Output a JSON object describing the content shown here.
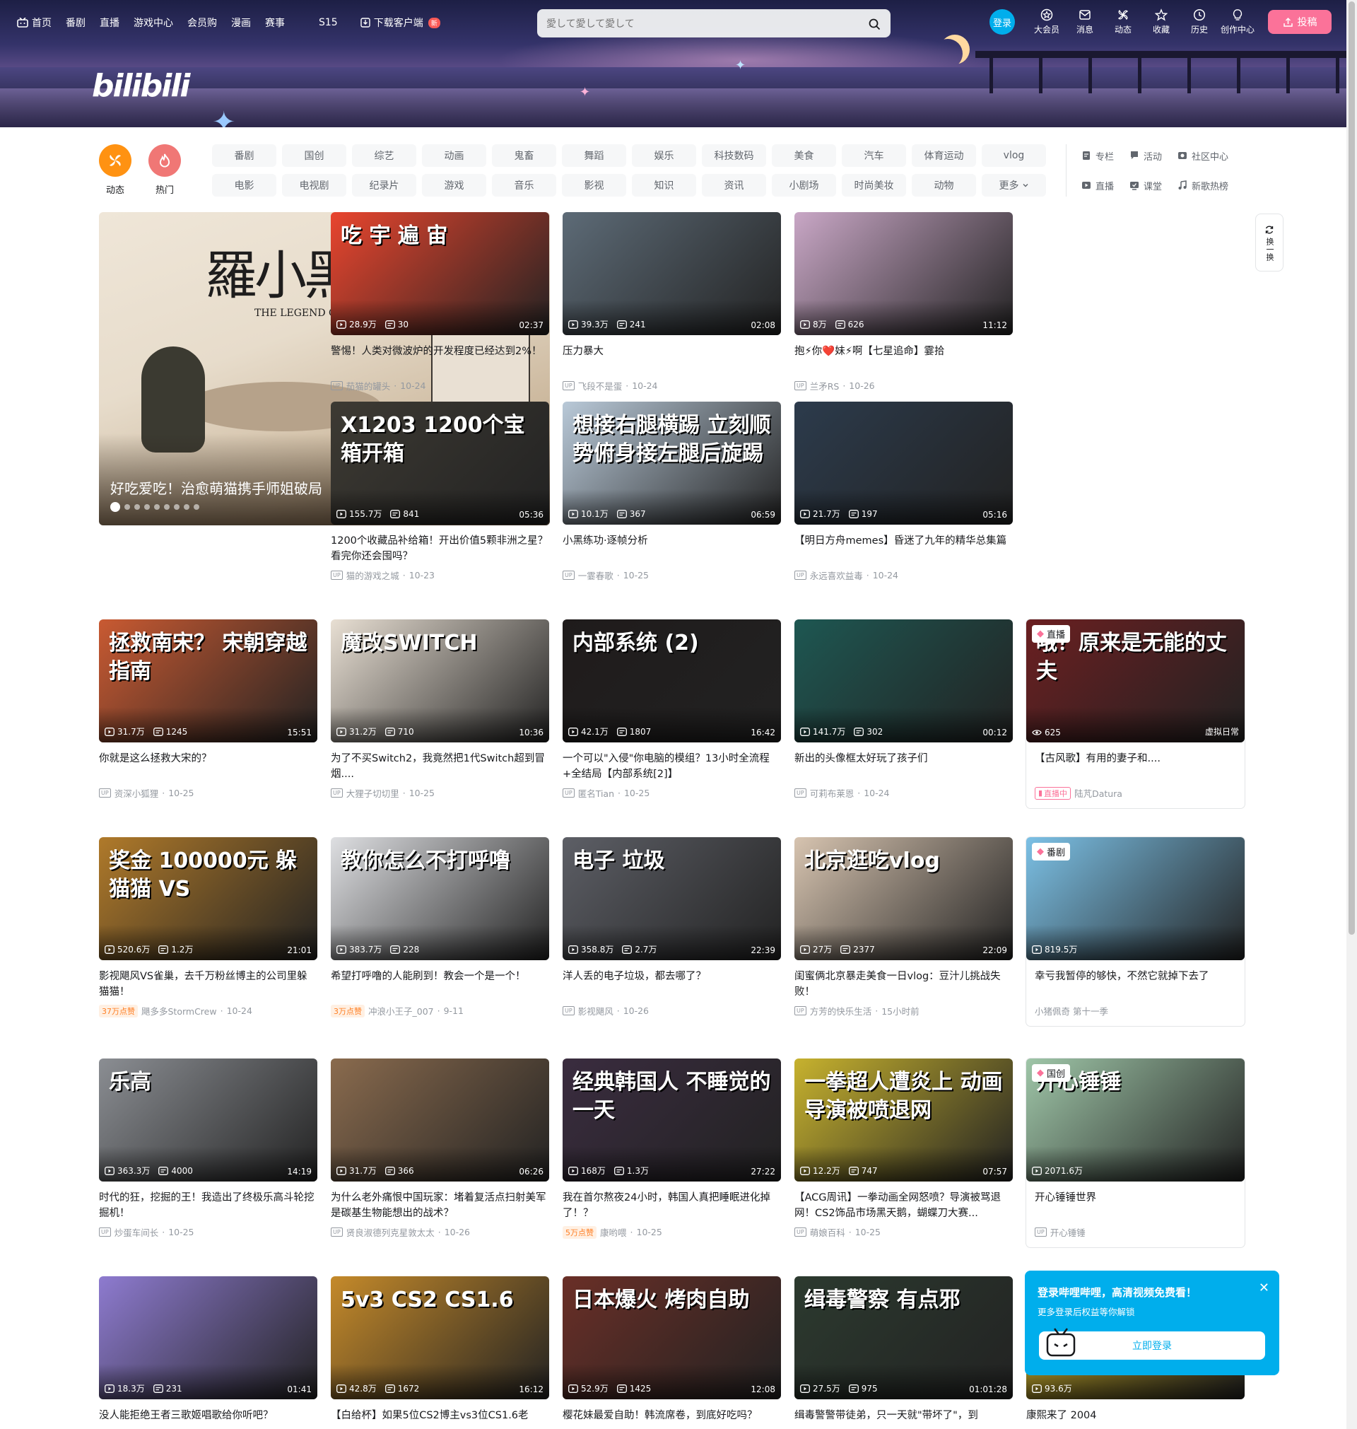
{
  "header": {
    "nav_left": [
      {
        "label": "首页",
        "icon": "tv-icon"
      },
      {
        "label": "番剧"
      },
      {
        "label": "直播"
      },
      {
        "label": "游戏中心"
      },
      {
        "label": "会员购"
      },
      {
        "label": "漫画"
      },
      {
        "label": "赛事"
      },
      {
        "label": "S15"
      },
      {
        "label": "下载客户端",
        "icon": "download-icon",
        "badge": "新"
      }
    ],
    "search_placeholder": "愛して愛して愛して",
    "login_label": "登录",
    "nav_right": [
      {
        "label": "大会员",
        "icon": "vip-icon"
      },
      {
        "label": "消息",
        "icon": "message-icon"
      },
      {
        "label": "动态",
        "icon": "dynamic-icon"
      },
      {
        "label": "收藏",
        "icon": "favorite-icon"
      },
      {
        "label": "历史",
        "icon": "history-icon"
      },
      {
        "label": "创作中心",
        "icon": "creator-icon"
      }
    ],
    "upload_label": "投稿",
    "logo_text": "bilibili"
  },
  "quick": [
    {
      "label": "动态",
      "icon": "dynamic-icon",
      "color": "#ff9212"
    },
    {
      "label": "热门",
      "icon": "fire-icon",
      "color": "#f07775"
    }
  ],
  "channels": [
    "番剧",
    "国创",
    "综艺",
    "动画",
    "鬼畜",
    "舞蹈",
    "娱乐",
    "科技数码",
    "美食",
    "汽车",
    "体育运动",
    "vlog",
    "电影",
    "电视剧",
    "纪录片",
    "游戏",
    "音乐",
    "影视",
    "知识",
    "资讯",
    "小剧场",
    "时尚美妆",
    "动物",
    "更多"
  ],
  "side_links": [
    {
      "label": "专栏",
      "icon": "column-icon"
    },
    {
      "label": "活动",
      "icon": "activity-icon"
    },
    {
      "label": "社区中心",
      "icon": "community-icon"
    },
    {
      "label": "直播",
      "icon": "live-icon"
    },
    {
      "label": "课堂",
      "icon": "classroom-icon"
    },
    {
      "label": "新歌热榜",
      "icon": "music-icon"
    }
  ],
  "carousel": {
    "caption": "好吃爱吃！治愈萌猫携手师姐破局",
    "art_title": "羅小黑戰記",
    "art_sub": "THE LEGEND OF HEI Ⅱ",
    "dots": 9
  },
  "refresh_label": "换一换",
  "cards": [
    {
      "title": "警惕！人类对微波炉的开发程度已经达到2%！",
      "views": "28.9万",
      "danmaku": "30",
      "duration": "02:37",
      "author": "茄猫的罐头",
      "date": "10-24",
      "art": "吃 宇 遍 宙",
      "bg": "#e9452e"
    },
    {
      "title": "压力暴大",
      "views": "39.3万",
      "danmaku": "241",
      "duration": "02:08",
      "author": "飞段不是蛋",
      "date": "10-24",
      "art": "",
      "bg": "#5d6b77"
    },
    {
      "title": "抱⚡你❤️妹⚡啊【七星追命】霎拾",
      "views": "8万",
      "danmaku": "626",
      "duration": "11:12",
      "author": "兰矛RS",
      "date": "10-26",
      "art": "",
      "bg": "#c9a7c6"
    },
    {
      "title": "1200个收藏品补给箱！开出价值5颗非洲之星？看完你还会囤吗？",
      "views": "155.7万",
      "danmaku": "841",
      "duration": "05:36",
      "author": "猫的游戏之城",
      "date": "10-23",
      "art": "X1203 1200个宝箱开箱",
      "bg": "#3d3a33"
    },
    {
      "title": "小黑练功·逐帧分析",
      "views": "10.1万",
      "danmaku": "367",
      "duration": "06:59",
      "author": "一霎春歌",
      "date": "10-25",
      "art": "想接右腿横踢 立刻顺势俯身接左腿后旋踢",
      "bg": "#b9c9d8"
    },
    {
      "title": "【明日方舟memes】昏迷了九年的精华总集篇",
      "views": "21.7万",
      "danmaku": "197",
      "duration": "05:16",
      "author": "永远喜欢益毒",
      "date": "10-24",
      "art": "",
      "bg": "#2c3b4c"
    },
    {
      "title": "你就是这么拯救大宋的？",
      "views": "31.7万",
      "danmaku": "1245",
      "duration": "15:51",
      "author": "资深小狐狸",
      "date": "10-25",
      "art": "拯救南宋？ 宋朝穿越指南",
      "bg": "#c95a32"
    },
    {
      "title": "为了不买Switch2，我竟然把1代Switch超到冒烟....",
      "views": "31.2万",
      "danmaku": "710",
      "duration": "10:36",
      "author": "大狸子切切里",
      "date": "10-25",
      "art": "魔改SWITCH",
      "bg": "#e8dfd3"
    },
    {
      "title": "一个可以\"入侵\"你电脑的模组？13小时全流程+全结局【内部系统[2]】",
      "views": "42.1万",
      "danmaku": "1807",
      "duration": "16:42",
      "author": "匿名Tian",
      "date": "10-25",
      "art": "内部系统 (2)",
      "bg": "#1f1b1b"
    },
    {
      "title": "新出的头像框太好玩了孩子们",
      "views": "141.7万",
      "danmaku": "302",
      "duration": "00:12",
      "author": "可莉布莱恩",
      "date": "10-24",
      "art": "",
      "bg": "#1e5752"
    },
    {
      "title": "【古风歌】有用的妻子和....",
      "views": "625",
      "danmaku": "",
      "duration": "虚拟日常",
      "author": "陆芃Datura",
      "date": "",
      "art": "哦？原来是无能的丈夫",
      "bg": "#6b1f21",
      "tag": "直播",
      "live": "直播中"
    },
    {
      "title": "影视飓风VS雀巢，去千万粉丝博主的公司里躲猫猫！",
      "views": "520.6万",
      "danmaku": "1.2万",
      "duration": "21:01",
      "author": "飓多多StormCrew",
      "date": "10-24",
      "art": "奖金 100000元 躲猫猫 VS",
      "bg": "#b07a2a",
      "hot": "37万点赞"
    },
    {
      "title": "希望打呼噜的人能刷到！教会一个是一个！",
      "views": "383.7万",
      "danmaku": "228",
      "duration": "",
      "author": "冲浪小王子_007",
      "date": "9-11",
      "art": "教你怎么不打呼噜",
      "bg": "#dedfe2",
      "hot": "3万点赞"
    },
    {
      "title": "洋人丢的电子垃圾，都去哪了？",
      "views": "358.8万",
      "danmaku": "2.7万",
      "duration": "22:39",
      "author": "影视飓风",
      "date": "10-26",
      "art": "电子 垃圾",
      "bg": "#5d5f66"
    },
    {
      "title": "闺蜜俩北京暴走美食一日vlog：豆汁儿挑战失败！",
      "views": "27万",
      "danmaku": "2377",
      "duration": "22:09",
      "author": "方芳的快乐生活",
      "date": "15小时前",
      "art": "北京逛吃vlog",
      "bg": "#d7c4b0"
    },
    {
      "title": "幸亏我暂停的够快，不然它就掉下去了",
      "views": "819.5万",
      "danmaku": "",
      "duration": "",
      "author": "小猪佩奇 第十一季",
      "date": "",
      "art": "",
      "bg": "#7cc1e6",
      "tag": "番剧"
    },
    {
      "title": "时代的狂，挖掘的王！我造出了终极乐高斗轮挖掘机！",
      "views": "363.3万",
      "danmaku": "4000",
      "duration": "14:19",
      "author": "炒蛋车间长",
      "date": "10-25",
      "art": "乐高",
      "bg": "#8b8e93"
    },
    {
      "title": "为什么老外痛恨中国玩家：堵着复活点扫射美军是碳基生物能想出的战术？",
      "views": "31.7万",
      "danmaku": "366",
      "duration": "06:26",
      "author": "贤良淑德列克星敦太太",
      "date": "10-26",
      "art": "",
      "bg": "#8a6b4e"
    },
    {
      "title": "我在首尔熬夜24小时，韩国人真把睡眠进化掉了！？",
      "views": "168万",
      "danmaku": "1.3万",
      "duration": "27:22",
      "author": "康哟喂",
      "date": "10-25",
      "art": "经典韩国人 不睡觉的一天",
      "bg": "#3a2c3f",
      "hot": "5万点赞"
    },
    {
      "title": "【ACG周讯】一拳动画全网怒喷？导演被骂退网！CS2饰品市场黑天鹅，蝴蝶刀大赛...",
      "views": "12.2万",
      "danmaku": "747",
      "duration": "07:57",
      "author": "萌娘百科",
      "date": "10-25",
      "art": "一拳超人遭炎上 动画导演被喷退网",
      "bg": "#c7b22e"
    },
    {
      "title": "开心锤锤世界",
      "views": "2071.6万",
      "danmaku": "",
      "duration": "",
      "author": "开心锤锤",
      "date": "",
      "art": "开心锤锤",
      "bg": "#9fc6a8",
      "tag": "国创"
    },
    {
      "title": "没人能拒绝王者三歌姬唱歌给你听吧？",
      "views": "18.3万",
      "danmaku": "231",
      "duration": "01:41",
      "author": "",
      "date": "",
      "art": "",
      "bg": "#8e7bd0"
    },
    {
      "title": "【白给杯】如果5位CS2博主vs3位CS1.6老",
      "views": "42.8万",
      "danmaku": "1672",
      "duration": "16:12",
      "author": "",
      "date": "",
      "art": "5v3 CS2 CS1.6",
      "bg": "#c58a2a"
    },
    {
      "title": "樱花妹最爱自助！韩流席卷，到底好吃吗？",
      "views": "52.9万",
      "danmaku": "1425",
      "duration": "12:08",
      "author": "",
      "date": "",
      "art": "日本爆火 烤肉自助",
      "bg": "#6a2f27"
    },
    {
      "title": "缉毒警警带徒弟，只一天就\"带坏了\"，到",
      "views": "27.5万",
      "danmaku": "975",
      "duration": "01:01:28",
      "author": "",
      "date": "",
      "art": "缉毒警察 有点邪",
      "bg": "#2c3a2f"
    },
    {
      "title": "康熙来了 2004",
      "views": "93.6万",
      "danmaku": "",
      "duration": "",
      "author": "",
      "date": "",
      "art": "",
      "bg": "#e8c62a"
    }
  ],
  "login_popup": {
    "title": "登录哔哩哔哩，高清视频免费看！",
    "subtitle": "更多登录后权益等你解锁",
    "button": "立即登录"
  }
}
